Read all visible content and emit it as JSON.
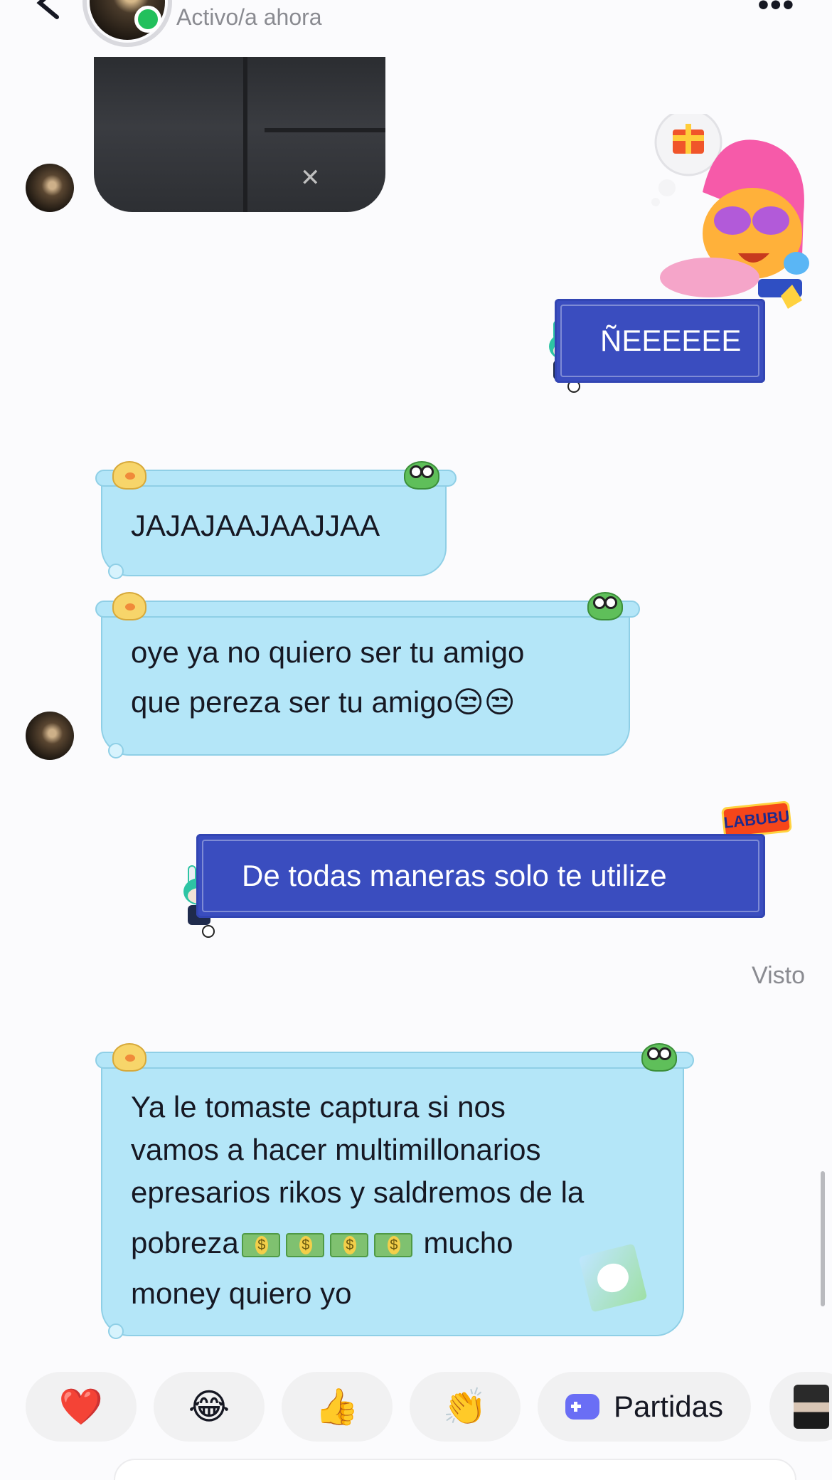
{
  "header": {
    "status": "Activo/a ahora",
    "more_icon": "more-dots-icon",
    "back_icon": "back-arrow-icon",
    "online_color": "#22c05c"
  },
  "messages": [
    {
      "type": "photo",
      "from": "peer"
    },
    {
      "type": "sticker",
      "from": "me"
    },
    {
      "type": "text",
      "from": "me",
      "text": "ÑEEEEEE"
    },
    {
      "type": "text",
      "from": "peer",
      "text": "JAJAJAAJAAJJAA"
    },
    {
      "type": "text",
      "from": "peer",
      "lines": [
        "oye ya no quiero ser tu amigo",
        "que pereza ser tu amigo😒😒"
      ]
    },
    {
      "type": "text",
      "from": "me",
      "text": "De todas maneras solo te utilize",
      "sticker_tag": "LABUBU"
    },
    {
      "type": "text",
      "from": "peer",
      "lines": [
        "Ya le tomaste captura si nos",
        "vamos a hacer multimillonarios",
        "epresarios rikos y saldremos de la"
      ],
      "line4_a": "pobreza",
      "line4_b": " mucho",
      "line5": "money quiero yo"
    }
  ],
  "seen_label": "Visto",
  "quick_reactions": [
    "❤️",
    "😂",
    "👍",
    "👏"
  ],
  "games_label": "Partidas",
  "colors": {
    "sent_bubble": "#3a4dbf",
    "received_bubble": "#b4e6f8",
    "background": "#fbfbfd"
  }
}
